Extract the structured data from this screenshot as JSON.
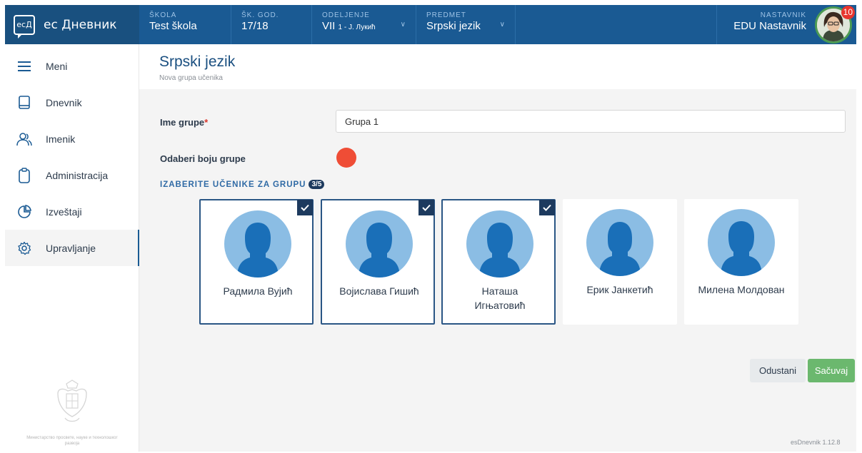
{
  "app": {
    "logo_text": "ecД",
    "name": "ес Дневник"
  },
  "topbar": {
    "school": {
      "label": "ŠKOLA",
      "value": "Test škola"
    },
    "year": {
      "label": "ŠK. GOD.",
      "value": "17/18"
    },
    "class": {
      "label": "ODELJENJE",
      "value": "VII",
      "sub": "1",
      "teacher": " - Ј. Лукић"
    },
    "subject": {
      "label": "PREDMET",
      "value": "Srpski jezik"
    },
    "teacher": {
      "label": "NASTAVNIK",
      "value": "EDU Nastavnik"
    },
    "notifications": "10"
  },
  "sidebar": {
    "items": [
      {
        "label": "Meni",
        "icon": "menu-icon"
      },
      {
        "label": "Dnevnik",
        "icon": "book-icon"
      },
      {
        "label": "Imenik",
        "icon": "users-icon"
      },
      {
        "label": "Administracija",
        "icon": "clipboard-icon"
      },
      {
        "label": "Izveštaji",
        "icon": "pie-chart-icon"
      },
      {
        "label": "Upravljanje",
        "icon": "gear-icon"
      }
    ],
    "footer": "Министарство просвете, науке и технолошког развоја"
  },
  "page": {
    "title": "Srpski jezik",
    "subtitle": "Nova grupa učenika"
  },
  "form": {
    "name_label": "Ime grupe",
    "required_mark": "*",
    "name_value": "Grupa 1",
    "color_label": "Odaberi boju grupe",
    "group_color": "#ef4d36",
    "select_title": "IZABERITE UČENIKE ZA GRUPU",
    "select_count": "3/5"
  },
  "students": [
    {
      "name": "Радмила Вујић",
      "selected": true
    },
    {
      "name": "Војислава Гишић",
      "selected": true
    },
    {
      "name": "Наташа Игњатовић",
      "selected": true
    },
    {
      "name": "Ерик Јанкетић",
      "selected": false
    },
    {
      "name": "Милена Молдован",
      "selected": false
    }
  ],
  "buttons": {
    "cancel": "Odustani",
    "save": "Sačuvaj"
  },
  "version": "esDnevnik 1.12.8",
  "colors": {
    "primary": "#1a5a93",
    "accent_blue": "#2f6aa5",
    "save_green": "#6bb86e",
    "avatar_bg": "#8bbde4",
    "avatar_fg": "#1a6fb8"
  }
}
